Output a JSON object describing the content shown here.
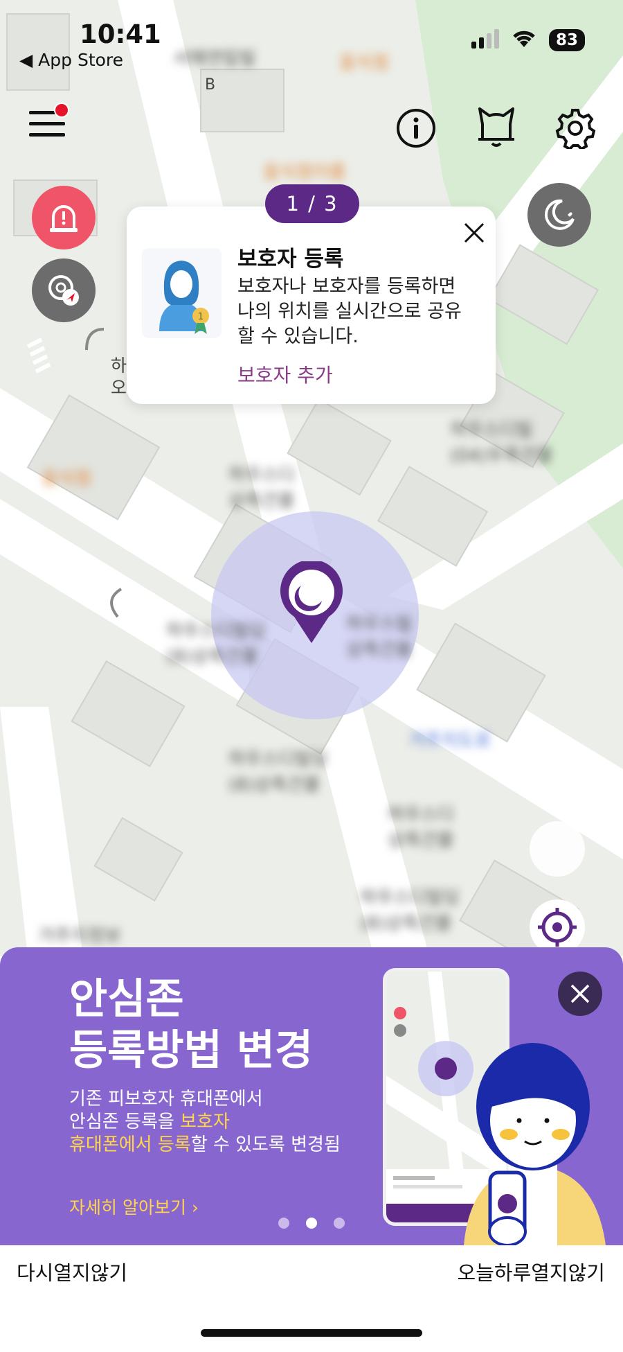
{
  "status_bar": {
    "time": "10:41",
    "back_label": "◀ App Store",
    "battery": "83"
  },
  "top_bar": {
    "menu_icon": "hamburger-menu-icon",
    "info_icon": "info-icon",
    "bell_icon": "cat-bell-icon",
    "settings_icon": "gear-icon",
    "notification_dot_color": "#e5142b"
  },
  "side_buttons": {
    "emergency_icon": "siren-icon",
    "location_share_icon": "location-share-icon",
    "night_mode_icon": "moon-icon"
  },
  "map": {
    "labels": [
      "B",
      "하",
      "오"
    ],
    "user_marker_icon": "moon-pin-icon"
  },
  "tooltip": {
    "step": "1 / 3",
    "title": "보호자 등록",
    "body": "보호자나 보호자를 등록하면 나의 위치를 실시간으로 공유할 수 있습니다.",
    "link": "보호자 추가",
    "close_icon": "close-icon"
  },
  "banner": {
    "title_line1": "안심존",
    "title_line2": "등록방법 변경",
    "desc_line1": "기존 피보호자 휴대폰에서",
    "desc_line2_a": "안심존 등록을 ",
    "desc_line2_b": "보호자",
    "desc_line3_a": "휴대폰에서 등록",
    "desc_line3_b": "할 수 있도록 변경됨",
    "more_link": "자세히 알아보기 ›",
    "pagination": {
      "count": 3,
      "active": 2
    },
    "accent_color": "#ffd54a",
    "background_color": "#8866d0"
  },
  "bottom_actions": {
    "dont_show_again": "다시열지않기",
    "dont_show_today": "오늘하루열지않기"
  }
}
